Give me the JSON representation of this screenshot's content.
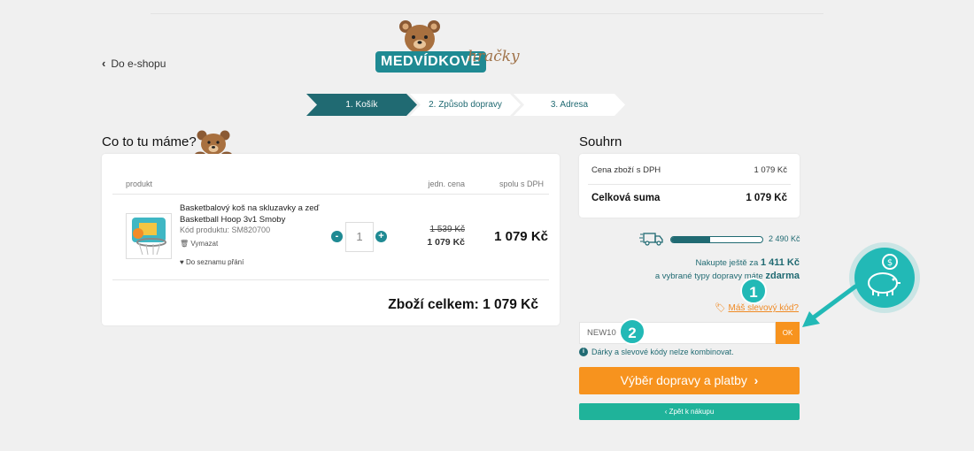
{
  "header": {
    "back_link": "Do e-shopu",
    "logo_banner": "MEDVÍDKOVÉ",
    "logo_script": "hračky"
  },
  "steps": [
    {
      "label": "1. Košík",
      "active": true
    },
    {
      "label": "2. Způsob dopravy",
      "active": false
    },
    {
      "label": "3. Adresa",
      "active": false
    }
  ],
  "cart": {
    "title": "Co to tu máme?",
    "columns": {
      "product": "produkt",
      "unit": "jedn. cena",
      "total": "spolu s DPH"
    },
    "item": {
      "name": "Basketbalový koš na skluzavky a zeď Basketball Hoop 3v1 Smoby",
      "code": "Kód produktu: SM820700",
      "remove": "Vymazat",
      "wishlist": "Do seznamu přání",
      "quantity": "1",
      "qty_minus": "-",
      "qty_plus": "+",
      "old_price": "1 539 Kč",
      "unit_price": "1 079 Kč",
      "line_total": "1 079 Kč"
    },
    "goods_total": "Zboží celkem: 1 079 Kč"
  },
  "summary": {
    "title": "Souhrn",
    "goods_label": "Cena zboží s DPH",
    "goods_value": "1 079 Kč",
    "total_label": "Celková suma",
    "total_value": "1 079 Kč"
  },
  "shipping": {
    "progress_fraction": 0.43,
    "threshold": "2 490 Kč",
    "msg_prefix": "Nakupte ještě za",
    "msg_amount": "1 411 Kč",
    "msg_line2_prefix": "a vybrané typy dopravy máte",
    "msg_free": "zdarma"
  },
  "coupon": {
    "link": "Máš slevový kód?",
    "value": "NEW10",
    "ok": "OK",
    "note": "Dárky a slevové kódy nelze kombinovat."
  },
  "actions": {
    "primary": "Výběr dopravy a platby",
    "secondary": "Zpět k nákupu"
  },
  "annotations": {
    "badge1": "1",
    "badge2": "2"
  },
  "colors": {
    "teal_dark": "#206a72",
    "teal": "#22b9b6",
    "orange": "#f7931e",
    "green": "#1fb39a"
  }
}
